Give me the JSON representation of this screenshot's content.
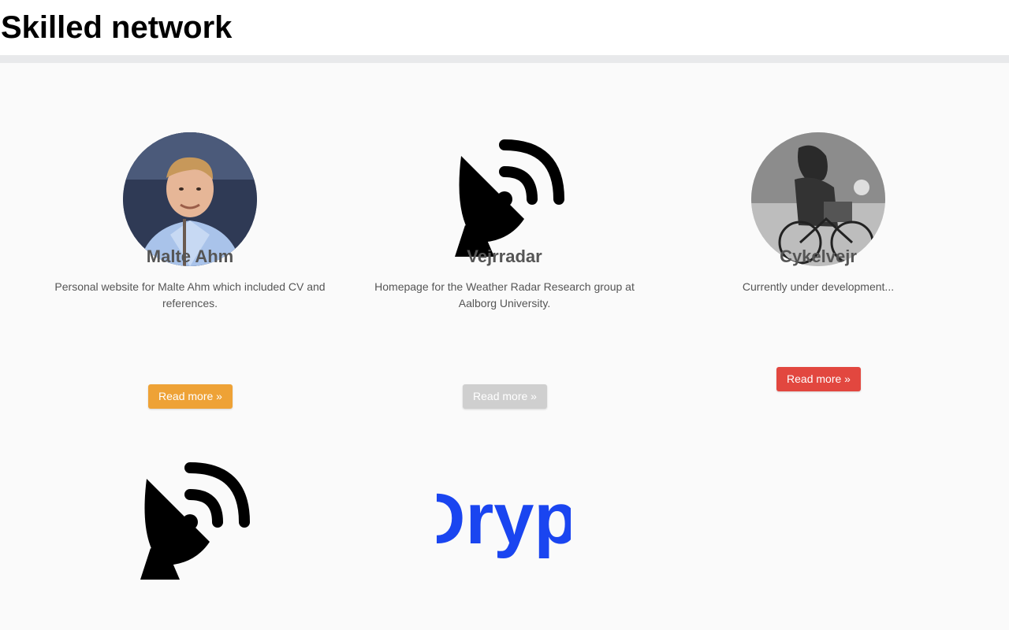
{
  "header": {
    "title": "Skilled network"
  },
  "projects": [
    {
      "title": "Malte Ahm",
      "description": "Personal website for Malte Ahm which included CV and references.",
      "button_label": "Read more »",
      "button_color": "#eea236",
      "image": "portrait-photo"
    },
    {
      "title": "Vejrradar",
      "description": "Homepage for the Weather Radar Research group at Aalborg University.",
      "button_label": "Read more »",
      "button_color": "#cfcfcf",
      "image": "satellite-dish-icon"
    },
    {
      "title": "Cykelvejr",
      "description": "Currently under development...",
      "button_label": "Read more »",
      "button_color": "#e2473f",
      "image": "cyclist-in-rain-photo"
    },
    {
      "image": "satellite-dish-icon"
    },
    {
      "image": "dryp-logo",
      "logo_text": "Dryp",
      "logo_color": "#1a45f0"
    }
  ]
}
